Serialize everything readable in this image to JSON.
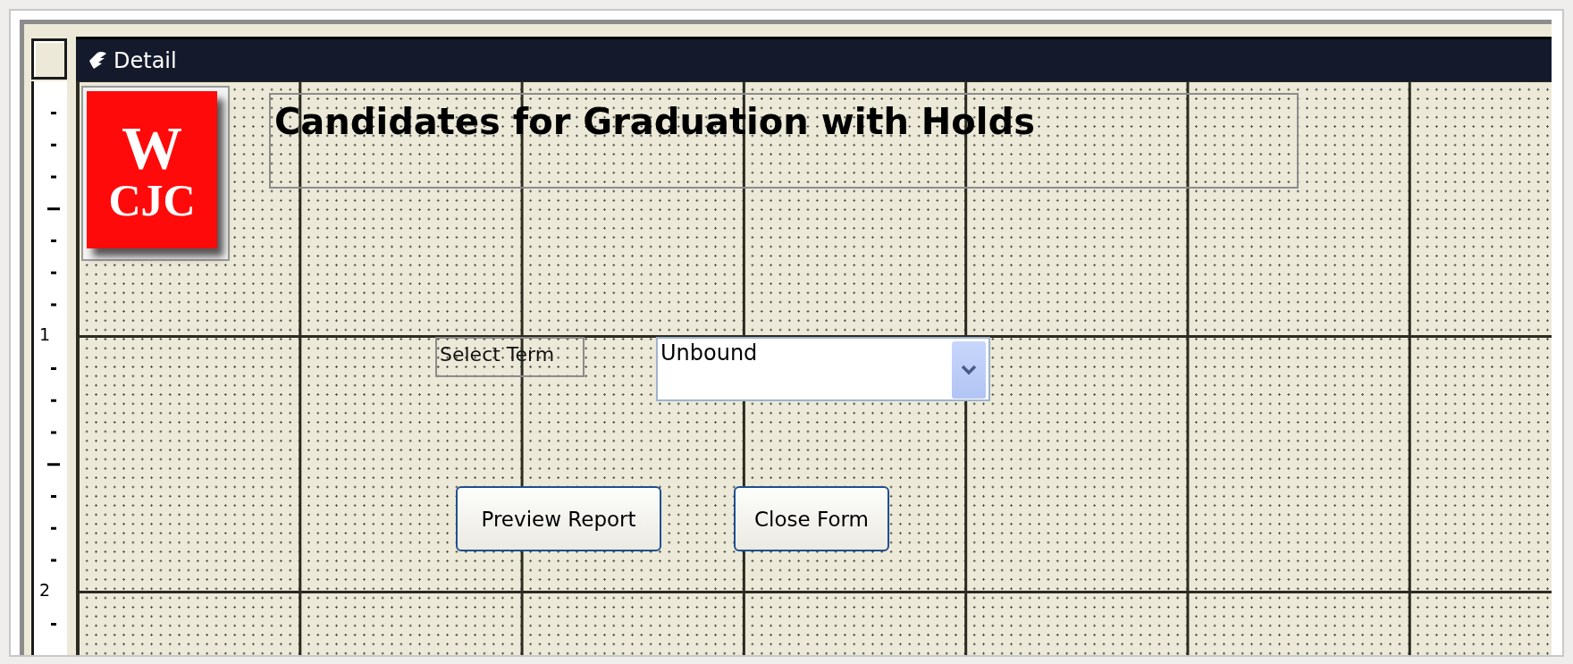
{
  "section_header": {
    "title": "Detail"
  },
  "ruler": {
    "labels": [
      "1",
      "2"
    ]
  },
  "logo": {
    "lines": [
      "W",
      "CJC"
    ]
  },
  "form": {
    "title": "Candidates for Graduation with Holds",
    "term_label": "Select Term",
    "term_combo": {
      "value": "Unbound"
    },
    "buttons": [
      {
        "label": "Preview Report"
      },
      {
        "label": "Close Form"
      }
    ]
  }
}
